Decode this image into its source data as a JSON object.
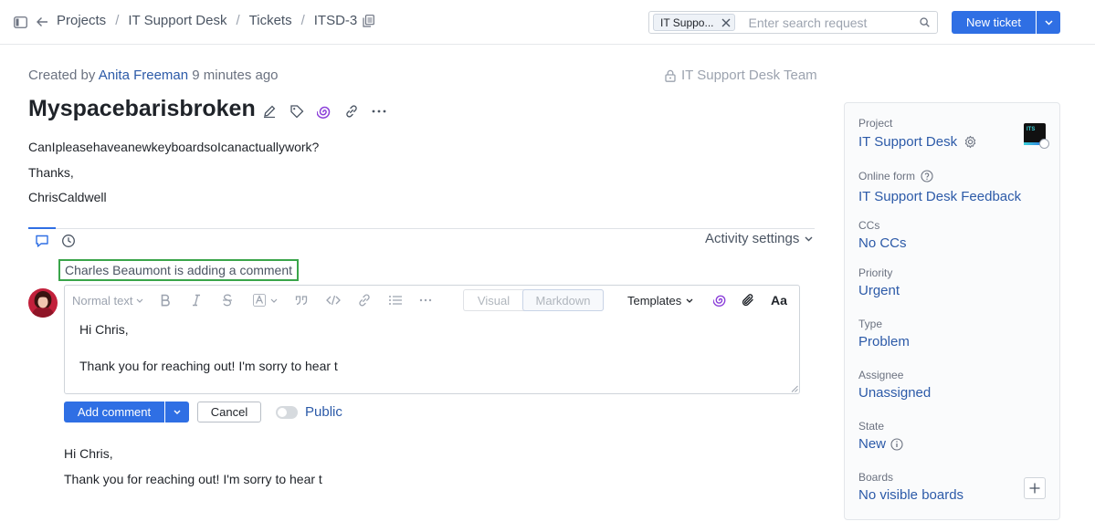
{
  "breadcrumb": [
    "Projects",
    "IT Support Desk",
    "Tickets",
    "ITSD-3"
  ],
  "search": {
    "chip_label": "IT Suppo...",
    "placeholder": "Enter search request"
  },
  "header": {
    "new_ticket_label": "New ticket"
  },
  "ticket": {
    "created_prefix": "Created by",
    "author": "Anita Freeman",
    "created_time": "9 minutes ago",
    "team": "IT Support Desk Team",
    "title": "Myspacebarisbroken",
    "description": [
      "CanIpleasehaveanewkeyboardsoIcanactuallywork?",
      "Thanks,",
      "ChrisCaldwell"
    ]
  },
  "activity": {
    "settings_label": "Activity settings",
    "typing_notice": "Charles Beaumont is adding a comment"
  },
  "editor": {
    "text_style": "Normal text",
    "mode_visual": "Visual",
    "mode_markdown": "Markdown",
    "templates_label": "Templates",
    "font_label": "Aa",
    "lines": [
      "Hi Chris,",
      "Thank you for reaching out! I'm sorry to hear t"
    ]
  },
  "comment_actions": {
    "add_label": "Add comment",
    "cancel_label": "Cancel",
    "public_label": "Public"
  },
  "preview_lines": [
    "Hi Chris,",
    "Thank you for reaching out! I'm sorry to hear t"
  ],
  "sidebar": {
    "project_label": "Project",
    "project_value": "IT Support Desk",
    "project_logo_text": "ITS",
    "online_form_label": "Online form",
    "online_form_value": "IT Support Desk Feedback",
    "ccs_label": "CCs",
    "ccs_value": "No CCs",
    "priority_label": "Priority",
    "priority_value": "Urgent",
    "type_label": "Type",
    "type_value": "Problem",
    "assignee_label": "Assignee",
    "assignee_value": "Unassigned",
    "state_label": "State",
    "state_value": "New",
    "boards_label": "Boards",
    "boards_value": "No visible boards"
  },
  "colors": {
    "accent": "#2f6fe4",
    "link": "#2c5aa8",
    "typing_border": "#3aa54a",
    "ai_icon": "#8b3fd9"
  }
}
